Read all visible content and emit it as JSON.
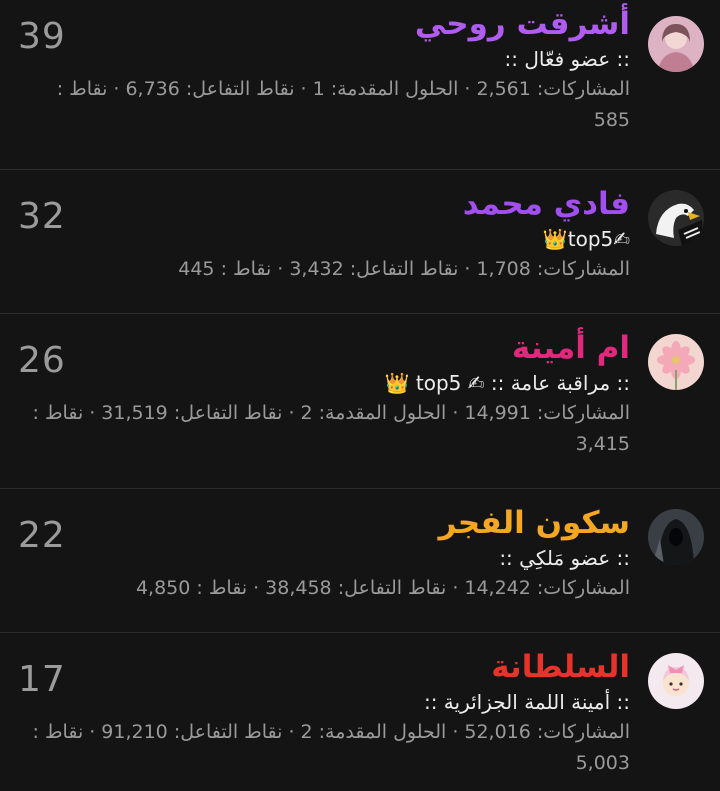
{
  "labels": {
    "posts": "المشاركات:",
    "solutions": "الحلول المقدمة:",
    "reactions": "نقاط التفاعل:",
    "points": "نقاط :"
  },
  "members": [
    {
      "name": "أشرقت روحي",
      "name_color": "#b05cf0",
      "title": ":: عضو فعّال ::",
      "posts": "2,561",
      "solutions": "1",
      "reactions": "6,736",
      "points": "585",
      "score": "39",
      "avatar_icon": "girl-portrait-avatar"
    },
    {
      "name": "فادي محمد",
      "name_color": "#a24ff0",
      "title": "✍top5👑",
      "posts": "1,708",
      "solutions": null,
      "reactions": "3,432",
      "points": "445",
      "score": "32",
      "avatar_icon": "eagle-avatar"
    },
    {
      "name": "ام أمينة",
      "name_color": "#e0287d",
      "title": ":: مراقبة عامة :: ✍ top5 👑",
      "posts": "14,991",
      "solutions": "2",
      "reactions": "31,519",
      "points": "3,415",
      "score": "26",
      "avatar_icon": "pink-flower-avatar"
    },
    {
      "name": "سكون الفجر",
      "name_color": "#f5a623",
      "title": ":: عضو مَلكِي ::",
      "posts": "14,242",
      "solutions": null,
      "reactions": "38,458",
      "points": "4,850",
      "score": "22",
      "avatar_icon": "hooded-figure-avatar"
    },
    {
      "name": "السلطانة",
      "name_color": "#e8332a",
      "title": ":: أمينة اللمة الجزائرية ::",
      "posts": "52,016",
      "solutions": "2",
      "reactions": "91,210",
      "points": "5,003",
      "score": "17",
      "avatar_icon": "cartoon-girl-avatar"
    }
  ]
}
